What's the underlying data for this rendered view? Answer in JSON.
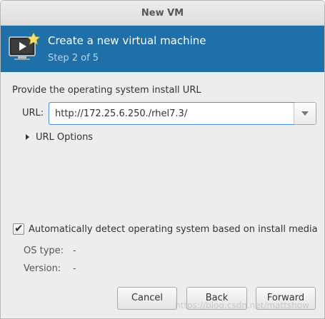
{
  "window": {
    "title": "New VM"
  },
  "header": {
    "title": "Create a new virtual machine",
    "step": "Step 2 of 5",
    "bg_color": "#1f6fa8",
    "icon": "vm-monitor-icon"
  },
  "form": {
    "prompt": "Provide the operating system install URL",
    "url_label": "URL:",
    "url_value": "http://172.25.6.250./rhel7.3/",
    "url_options_label": "URL Options",
    "auto_detect_label": "Automatically detect operating system based on install media",
    "auto_detect_checked": true,
    "os_type_label": "OS type:",
    "os_type_value": "-",
    "version_label": "Version:",
    "version_value": "-"
  },
  "buttons": {
    "cancel": "Cancel",
    "back": "Back",
    "forward": "Forward"
  },
  "watermark": "https://blog.csdn.net/mattshow"
}
